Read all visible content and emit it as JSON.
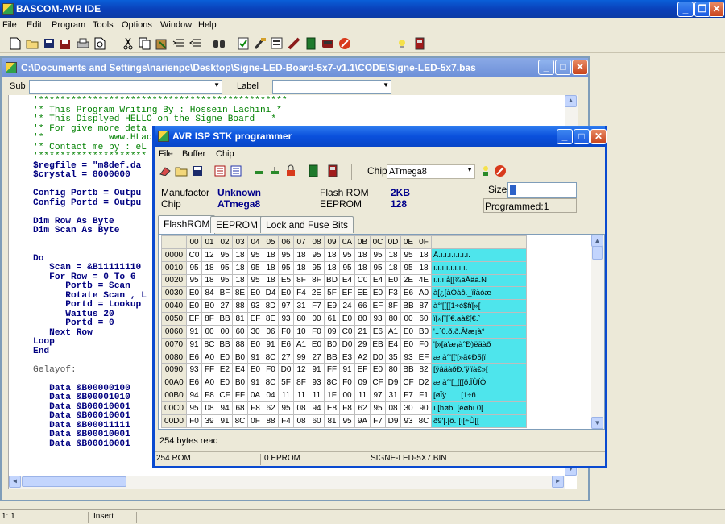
{
  "app": {
    "title": "BASCOM-AVR IDE",
    "menu": [
      "File",
      "Edit",
      "Program",
      "Tools",
      "Options",
      "Window",
      "Help"
    ]
  },
  "toolbar_icons": [
    "new-file-icon",
    "open-folder-icon",
    "save-icon",
    "save-as-icon",
    "print-icon",
    "print-preview-icon",
    "cut-icon",
    "copy-icon",
    "paste-icon",
    "indent-icon",
    "unindent-icon",
    "find-icon",
    "syntax-check-icon",
    "compile-icon",
    "show-result-icon",
    "simulate-icon",
    "program-chip-icon",
    "terminal-icon",
    "stop-icon",
    "light-bulb-icon",
    "lcd-designer-icon"
  ],
  "editor": {
    "title": "C:\\Documents and Settings\\narienpc\\Desktop\\Signe-LED-Board-5x7-v1.1\\CODE\\Signe-LED-5x7.bas",
    "sub_label": "Sub",
    "label_label": "Label",
    "lines": [
      {
        "t": "'**********************************************",
        "c": "cmt"
      },
      {
        "t": "'* This Program Writing By : Hossein Lachini *",
        "c": "cmt"
      },
      {
        "t": "'* This Displyed HELLO on the Signe Board   *",
        "c": "cmt"
      },
      {
        "t": "'* For give more deta",
        "c": "cmt"
      },
      {
        "t": "'*            www.HLac",
        "c": "cmt"
      },
      {
        "t": "'* Contact me by : eL",
        "c": "cmt"
      },
      {
        "t": "'********************",
        "c": "cmt"
      },
      {
        "t": "$regfile = \"m8def.da",
        "c": "kw"
      },
      {
        "t": "$crystal = 8000000",
        "c": "kw"
      },
      {
        "t": "",
        "c": ""
      },
      {
        "t": "Config Portb = Outpu",
        "c": "kw"
      },
      {
        "t": "Config Portd = Outpu",
        "c": "kw"
      },
      {
        "t": "",
        "c": ""
      },
      {
        "t": "Dim Row As Byte",
        "c": "kw"
      },
      {
        "t": "Dim Scan As Byte",
        "c": "kw"
      },
      {
        "t": "",
        "c": ""
      },
      {
        "t": "",
        "c": ""
      },
      {
        "t": "Do",
        "c": "kw"
      },
      {
        "t": "   Scan = &B11111110",
        "c": "mix"
      },
      {
        "t": "   For Row = 0 To 6",
        "c": "kw"
      },
      {
        "t": "      Portb = Scan",
        "c": "kw"
      },
      {
        "t": "      Rotate Scan , L",
        "c": "kw"
      },
      {
        "t": "      Portd = Lookup",
        "c": "kw"
      },
      {
        "t": "      Waitus 20",
        "c": "kw"
      },
      {
        "t": "      Portd = 0",
        "c": "kw"
      },
      {
        "t": "   Next Row",
        "c": "kw"
      },
      {
        "t": "Loop",
        "c": "kw"
      },
      {
        "t": "End",
        "c": "kw"
      },
      {
        "t": "",
        "c": ""
      },
      {
        "t": "Gelayof:",
        "c": "lbl"
      },
      {
        "t": "",
        "c": ""
      },
      {
        "t": "   Data &B00000100",
        "c": "data"
      },
      {
        "t": "   Data &B00001010",
        "c": "data"
      },
      {
        "t": "   Data &B00010001",
        "c": "data"
      },
      {
        "t": "   Data &B00010001",
        "c": "data"
      },
      {
        "t": "   Data &B00011111",
        "c": "data"
      },
      {
        "t": "   Data &B00010001",
        "c": "data"
      },
      {
        "t": "   Data &B00010001",
        "c": "data"
      }
    ]
  },
  "status": {
    "position": "1: 1",
    "mode": "Insert"
  },
  "programmer": {
    "title": "AVR ISP STK programmer",
    "menu": [
      "File",
      "Buffer",
      "Chip"
    ],
    "chip_label": "Chip",
    "chip_value": "ATmega8",
    "manufactor_label": "Manufactor",
    "manufactor_value": "Unknown",
    "chip_field_label": "Chip",
    "chip_field_value": "ATmega8",
    "flash_label": "Flash ROM",
    "flash_value": "2KB",
    "eeprom_label": "EEPROM",
    "eeprom_value": "128",
    "size_label": "Size",
    "programmed_text": "Programmed:1",
    "tabs": [
      "FlashROM",
      "EEPROM",
      "Lock and Fuse Bits"
    ],
    "columns": [
      "00",
      "01",
      "02",
      "03",
      "04",
      "05",
      "06",
      "07",
      "08",
      "09",
      "0A",
      "0B",
      "0C",
      "0D",
      "0E",
      "0F"
    ],
    "rows": [
      {
        "addr": "0000",
        "bytes": [
          "C0",
          "12",
          "95",
          "18",
          "95",
          "18",
          "95",
          "18",
          "95",
          "18",
          "95",
          "18",
          "95",
          "18",
          "95",
          "18"
        ],
        "ascii": "À.ı.ı.ı.ı.ı.ı.ı."
      },
      {
        "addr": "0010",
        "bytes": [
          "95",
          "18",
          "95",
          "18",
          "95",
          "18",
          "95",
          "18",
          "95",
          "18",
          "95",
          "18",
          "95",
          "18",
          "95",
          "18"
        ],
        "ascii": "ı.ı.ı.ı.ı.ı.ı.ı."
      },
      {
        "addr": "0020",
        "bytes": [
          "95",
          "18",
          "95",
          "18",
          "95",
          "18",
          "E5",
          "8F",
          "8F",
          "BD",
          "E4",
          "C0",
          "E4",
          "E0",
          "2E",
          "4E"
        ],
        "ascii": "ı.ı.ı.å[[¾äÀäà.N"
      },
      {
        "addr": "0030",
        "bytes": [
          "E0",
          "84",
          "BF",
          "8E",
          "E0",
          "D4",
          "E0",
          "F4",
          "2E",
          "5F",
          "EF",
          "EE",
          "E0",
          "F3",
          "E6",
          "A0"
        ],
        "ascii": "à[¿[àÔàô._ïîàóæ"
      },
      {
        "addr": "0040",
        "bytes": [
          "E0",
          "B0",
          "27",
          "88",
          "93",
          "8D",
          "97",
          "31",
          "F7",
          "E9",
          "24",
          "66",
          "EF",
          "8F",
          "BB",
          "87"
        ],
        "ascii": "à°'[[[[1÷é$fï[»["
      },
      {
        "addr": "0050",
        "bytes": [
          "EF",
          "8F",
          "BB",
          "81",
          "EF",
          "8E",
          "93",
          "80",
          "00",
          "61",
          "E0",
          "80",
          "93",
          "80",
          "00",
          "60"
        ],
        "ascii": "ï[»[ï[[€.aà€[€.`"
      },
      {
        "addr": "0060",
        "bytes": [
          "91",
          "00",
          "00",
          "60",
          "30",
          "06",
          "F0",
          "10",
          "F0",
          "09",
          "C0",
          "21",
          "E6",
          "A1",
          "E0",
          "B0"
        ],
        "ascii": "'..`0.ð.ð.À!æ¡à°"
      },
      {
        "addr": "0070",
        "bytes": [
          "91",
          "8C",
          "BB",
          "88",
          "E0",
          "91",
          "E6",
          "A1",
          "E0",
          "B0",
          "D0",
          "29",
          "EB",
          "E4",
          "E0",
          "F0"
        ],
        "ascii": "'[»[à'æ¡à°Ð)ëäàð"
      },
      {
        "addr": "0080",
        "bytes": [
          "E6",
          "A0",
          "E0",
          "B0",
          "91",
          "8C",
          "27",
          "99",
          "27",
          "BB",
          "E3",
          "A2",
          "D0",
          "35",
          "93",
          "EF"
        ],
        "ascii": "æ à°'[['[»ã¢Ð5[ï"
      },
      {
        "addr": "0090",
        "bytes": [
          "93",
          "FF",
          "E2",
          "E4",
          "E0",
          "F0",
          "D0",
          "12",
          "91",
          "FF",
          "91",
          "EF",
          "E0",
          "80",
          "BB",
          "82"
        ],
        "ascii": "[ÿâäàðÐ.'ÿ'ïà€»["
      },
      {
        "addr": "00A0",
        "bytes": [
          "E6",
          "A0",
          "E0",
          "B0",
          "91",
          "8C",
          "5F",
          "8F",
          "93",
          "8C",
          "F0",
          "09",
          "CF",
          "D9",
          "CF",
          "D2"
        ],
        "ascii": "æ à°'[_[[[ð.ÏÙÏÒ"
      },
      {
        "addr": "00B0",
        "bytes": [
          "94",
          "F8",
          "CF",
          "FF",
          "0A",
          "04",
          "11",
          "11",
          "11",
          "1F",
          "00",
          "11",
          "97",
          "31",
          "F7",
          "F1"
        ],
        "ascii": "[øÏÿ.......[1÷ñ"
      },
      {
        "addr": "00C0",
        "bytes": [
          "95",
          "08",
          "94",
          "68",
          "F8",
          "62",
          "95",
          "08",
          "94",
          "E8",
          "F8",
          "62",
          "95",
          "08",
          "30",
          "90"
        ],
        "ascii": "ı.[høbı.[èøbı.0["
      },
      {
        "addr": "00D0",
        "bytes": [
          "F0",
          "39",
          "91",
          "8C",
          "0F",
          "88",
          "F4",
          "08",
          "60",
          "81",
          "95",
          "9A",
          "F7",
          "D9",
          "93",
          "8C"
        ],
        "ascii": "ð9'[.[ô.`[ı[÷Ù[["
      }
    ],
    "bytes_read": "254 bytes read",
    "status": [
      "254 ROM",
      "0 EPROM",
      "SIGNE-LED-5X7.BIN"
    ]
  }
}
